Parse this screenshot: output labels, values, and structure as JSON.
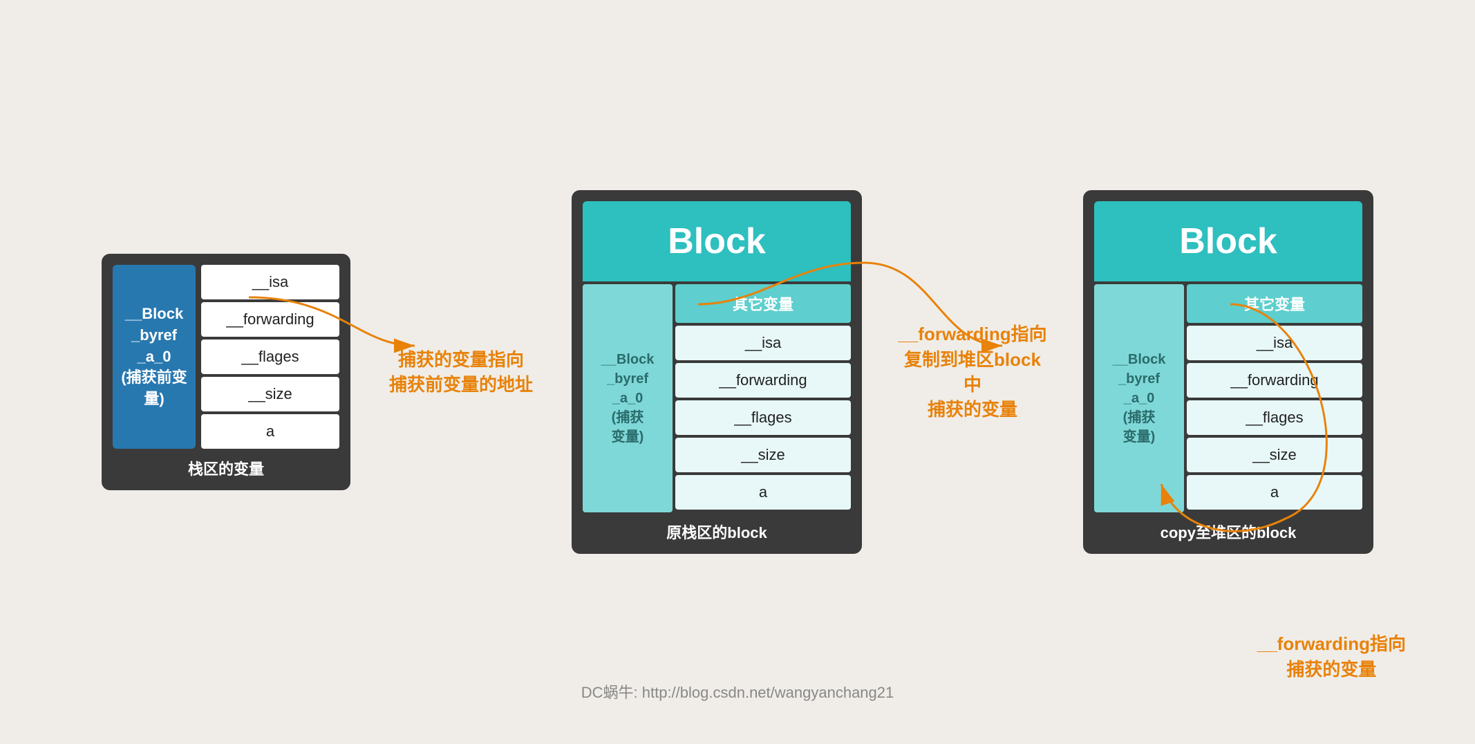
{
  "left_box": {
    "left_col_label": "__Block\n_byref\n_a_0\n(捕获前变量)",
    "rows": [
      "__isa",
      "__forwarding",
      "__flages",
      "__size",
      "a"
    ],
    "label": "栈区的变量"
  },
  "middle_box": {
    "header": "Block",
    "sub_header": "其它变量",
    "left_col_label": "__Block\n_byref\n_a_0\n(捕获\n变量)",
    "rows": [
      "__isa",
      "__forwarding",
      "__flages",
      "__size",
      "a"
    ],
    "label": "原栈区的block"
  },
  "right_box": {
    "header": "Block",
    "sub_header": "其它变量",
    "left_col_label": "__Block\n_byref\n_a_0\n(捕获\n变量)",
    "rows": [
      "__isa",
      "__forwarding",
      "__flages",
      "__size",
      "a"
    ],
    "label": "copy至堆区的block"
  },
  "annotation_left": "捕获的变量指向\n捕获前变量的地址",
  "annotation_middle": "__forwarding指向\n复制到堆区block中\n捕获的变量",
  "annotation_bottom": "__forwarding指向\n捕获的变量",
  "watermark": "DC蜗牛: http://blog.csdn.net/wangyanchang21"
}
